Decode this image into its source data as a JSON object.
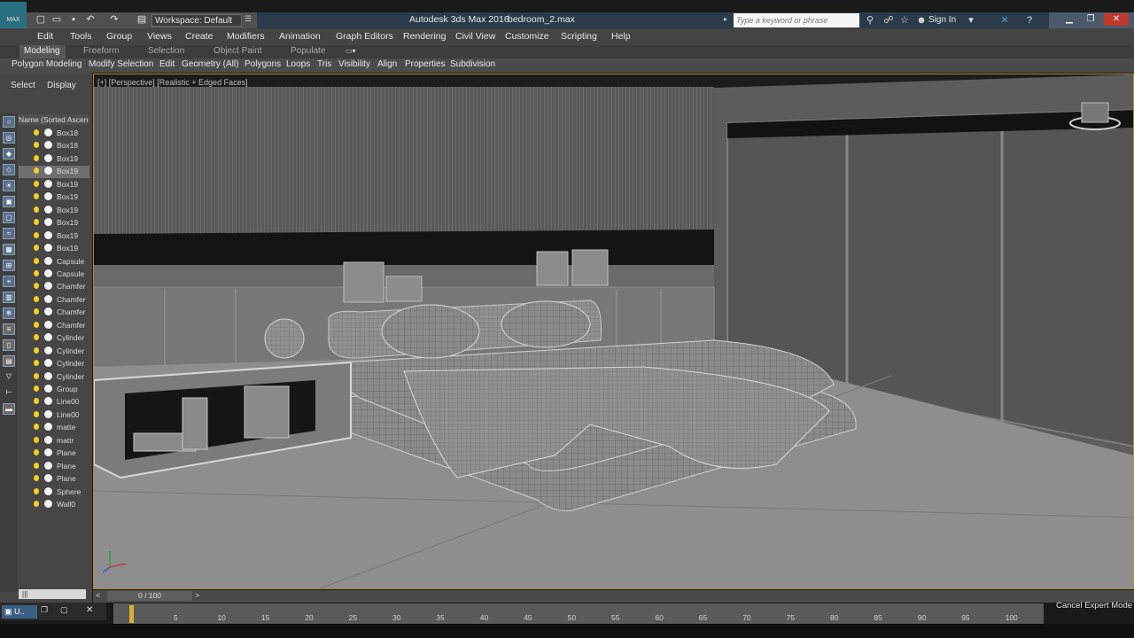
{
  "titlebar": {
    "workspace_label": "Workspace: Default",
    "app_title": "Autodesk 3ds Max 2016",
    "file_title": "bedroom_2.max",
    "search_placeholder": "Type a keyword or phrase",
    "signin_label": "Sign In",
    "logo_text": "MAX"
  },
  "menu": [
    "Edit",
    "Tools",
    "Group",
    "Views",
    "Create",
    "Modifiers",
    "Animation",
    "Graph Editors",
    "Rendering",
    "Civil View",
    "Customize",
    "Scripting",
    "Help"
  ],
  "ribbon_tabs": [
    "Modeling",
    "Freeform",
    "Selection",
    "Object Paint",
    "Populate"
  ],
  "ribbon_items": [
    "Polygon Modeling",
    "Modify Selection",
    "Edit",
    "Geometry (All)",
    "Polygons",
    "Loops",
    "Tris",
    "Visibility",
    "Align",
    "Properties",
    "Subdivision"
  ],
  "scene_explorer": {
    "tabs": [
      "Select",
      "Display"
    ],
    "column_header": "Name (Sorted Ascending)",
    "items": [
      "Box18",
      "Box18",
      "Box19",
      "Box19",
      "Box19",
      "Box19",
      "Box19",
      "Box19",
      "Box19",
      "Box19",
      "Capsule",
      "Capsule",
      "Chamfer",
      "Chamfer",
      "Chamfer",
      "Chamfer",
      "Cylinder",
      "Cylinder",
      "Cylinder",
      "Cylinder",
      "Group",
      "Line00",
      "Line00",
      "matte",
      "mattr",
      "Plane",
      "Plane",
      "Plane",
      "Sphere",
      "Wall0"
    ],
    "scroll_label": "|||"
  },
  "viewport": {
    "label": "[+] [Perspective] [Realistic + Edged Faces]"
  },
  "timeline": {
    "frame": "0 / 100",
    "ticks": [
      "5",
      "10",
      "15",
      "20",
      "25",
      "30",
      "35",
      "40",
      "45",
      "50",
      "55",
      "60",
      "65",
      "70",
      "75",
      "80",
      "85",
      "90",
      "95",
      "100"
    ],
    "expert_label": "Cancel Expert Mode"
  },
  "colors": {
    "accent": "#a9902e",
    "titlebar": "#2b3b4a",
    "viewport_bg": "#4a4a4a"
  }
}
